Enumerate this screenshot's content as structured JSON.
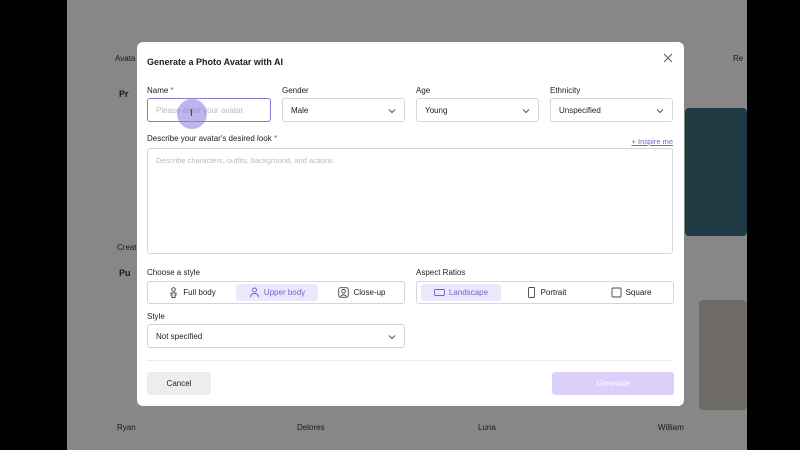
{
  "background": {
    "avatar_label": "Avata",
    "section1": "Pr",
    "section2": "Pu",
    "created_label": "Creat",
    "sort_label": "Re",
    "names": [
      "Ryan",
      "Delores",
      "Luna",
      "William"
    ]
  },
  "modal": {
    "title": "Generate a Photo Avatar with AI",
    "name": {
      "label": "Name",
      "required": "*",
      "placeholder": "Please enter your avatar",
      "value": ""
    },
    "gender": {
      "label": "Gender",
      "value": "Male"
    },
    "age": {
      "label": "Age",
      "value": "Young"
    },
    "ethnicity": {
      "label": "Ethnicity",
      "value": "Unspecified"
    },
    "look": {
      "label": "Describe your avatar's desired look",
      "required": "*",
      "inspire": "+ Inspire me",
      "placeholder": "Describe characters, outfits, background, and actions."
    },
    "style_choice": {
      "label": "Choose a style",
      "options": [
        "Full body",
        "Upper body",
        "Close-up"
      ],
      "selected": "Upper body"
    },
    "aspect": {
      "label": "Aspect Ratios",
      "options": [
        "Landscape",
        "Portrait",
        "Square"
      ],
      "selected": "Landscape"
    },
    "style": {
      "label": "Style",
      "value": "Not specified"
    },
    "cancel_label": "Cancel",
    "generate_label": "Generate"
  },
  "colors": {
    "accent": "#7b5cd6",
    "accent_soft": "#ece8fb",
    "disabled": "#dcd0fa"
  }
}
